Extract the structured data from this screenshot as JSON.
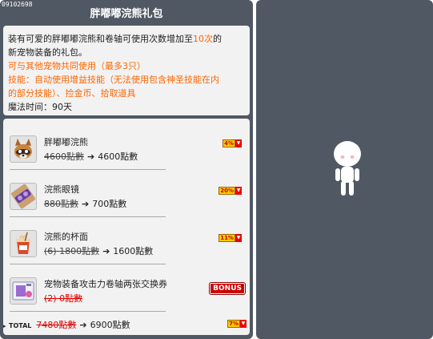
{
  "product_id": "09102698",
  "title": "胖嘟嘟浣熊礼包",
  "description": {
    "line1_prefix": "装有可爱的胖嘟嘟浣熊和卷轴可使用次数增加至",
    "line1_highlight": "10次",
    "line1_suffix": "的",
    "line2": "新宠物装备的礼包。",
    "line3": "可与其他宠物共同使用（最多3只）",
    "line4": "技能：自动使用增益技能（无法使用包含神圣技能在内",
    "line5": "的部分技能）、捡金币、拾取道具",
    "line6": "魔法时间：90天"
  },
  "items": [
    {
      "name": "胖嘟嘟浣熊",
      "original_price": "4600點數",
      "arrow": "➔",
      "sale_price": "4600點數",
      "discount": "4%",
      "icon": "raccoon-icon"
    },
    {
      "name": "浣熊眼镜",
      "original_price": "880點數",
      "arrow": "➔",
      "sale_price": "700點數",
      "discount": "20%",
      "icon": "glasses-icon"
    },
    {
      "name": "浣熊的杯面",
      "original_price": "(6) 1800點數",
      "arrow": "➔",
      "sale_price": "1600點數",
      "discount": "11%",
      "icon": "cup-noodle-icon"
    },
    {
      "name": "宠物装备攻击力卷轴两张交换券",
      "original_price": "(2) 0點數",
      "bonus": "BONUS",
      "icon": "scroll-coupon-icon"
    }
  ],
  "total": {
    "label": "TOTAL",
    "original_price": "7480點數",
    "arrow": "➔",
    "sale_price": "6900點數",
    "discount": "7%"
  },
  "down_arrow": "▼",
  "colors": {
    "panel": "#505863",
    "highlight": "#ff6600",
    "strike_red": "#e00000"
  }
}
